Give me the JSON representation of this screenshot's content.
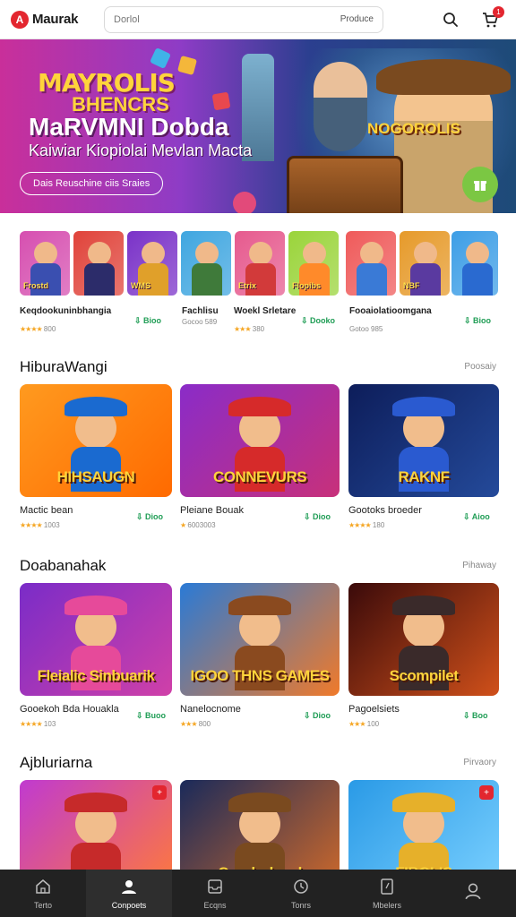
{
  "app": {
    "logo_letter": "A",
    "name": "Maurak"
  },
  "search": {
    "placeholder": "Dorlol",
    "right_label": "Produce"
  },
  "header": {
    "notification_count": "1"
  },
  "hero": {
    "title_line1": "MAYROLIS",
    "title_line2": "BHENCRS",
    "title_line3": "MaRVMNI Dobda",
    "subtitle": "Kaiwiar Kiopiolai Mevlan Macta",
    "side_logo": "NOGOROLIS",
    "cta_label": "Dais Reuschine ciis Sraies"
  },
  "featured": {
    "tiles": [
      {
        "tag": "Frostd",
        "bg": "#d64fb0"
      },
      {
        "tag": "",
        "bg": "#e0433a"
      },
      {
        "tag": "WMS",
        "bg": "#7a32c8"
      },
      {
        "tag": "",
        "bg": "#3fa6e0"
      },
      {
        "tag": "Etrix",
        "bg": "#e65a8e"
      },
      {
        "tag": "Flopibs",
        "bg": "#9ad43a"
      },
      {
        "tag": "",
        "bg": "#ef5a5a"
      },
      {
        "tag": "NBF",
        "bg": "#e69a2a"
      },
      {
        "tag": "",
        "bg": "#3d9ee6"
      }
    ],
    "items": [
      {
        "name": "Keqdookuninbhangia",
        "rating": "★★★★",
        "rating_text": "800",
        "get": "Bioo"
      },
      {
        "name": "Fachlisu",
        "rating": "",
        "rating_text": "Gocoo 589",
        "get": ""
      },
      {
        "name": "Woekl Srletare",
        "rating": "★★★",
        "rating_text": "380",
        "get": "Dooko"
      },
      {
        "name": "Fooaiolatioomgana",
        "rating": "",
        "rating_text": "Gotoo 985",
        "get": "Bioo"
      }
    ]
  },
  "sections": [
    {
      "title": "HiburaWangi",
      "more": "Poosaiy",
      "cards": [
        {
          "caption": "HIHSAUGN",
          "name": "Mactic bean",
          "rating": "★★★★",
          "rating_text": "1003",
          "get": "Dioo"
        },
        {
          "caption": "CONNEVURS",
          "name": "Pleiane Bouak",
          "rating": "★",
          "rating_text": "6003003",
          "get": "Dioo"
        },
        {
          "caption": "RAKNF",
          "name": "Gootoks broeder",
          "rating": "★★★★",
          "rating_text": "180",
          "get": "Aioo"
        }
      ]
    },
    {
      "title": "Doabanahak",
      "more": "Pihaway",
      "cards": [
        {
          "caption": "Fleialic Sinbuarik",
          "name": "Gooekoh Bda Houakla",
          "rating": "★★★★",
          "rating_text": "103",
          "get": "Buoo"
        },
        {
          "caption": "IGOO THNS GAMES",
          "name": "Nanelocnome",
          "rating": "★★★",
          "rating_text": "800",
          "get": "Dioo"
        },
        {
          "caption": "Scompilet",
          "name": "Pagoelsiets",
          "rating": "★★★",
          "rating_text": "100",
          "get": "Boo"
        }
      ]
    },
    {
      "title": "Ajbluriarna",
      "more": "Pirvaory",
      "cards": [
        {
          "caption": "",
          "name": "",
          "rating": "",
          "rating_text": "",
          "get": ""
        },
        {
          "caption": "Cuudrplanel",
          "name": "",
          "rating": "",
          "rating_text": "",
          "get": ""
        },
        {
          "caption": "FIBOLIS",
          "name": "",
          "rating": "",
          "rating_text": "",
          "get": ""
        }
      ]
    }
  ],
  "bottom_nav": [
    {
      "label": "Terto",
      "icon": "home-icon"
    },
    {
      "label": "Conpoets",
      "icon": "profile-icon"
    },
    {
      "label": "Ecqns",
      "icon": "inbox-icon"
    },
    {
      "label": "Tonrs",
      "icon": "clock-icon"
    },
    {
      "label": "Mbelers",
      "icon": "document-icon"
    },
    {
      "label": "",
      "icon": "user-icon"
    }
  ],
  "colors": {
    "brand": "#e3262f",
    "get_green": "#1f9d55",
    "nav_bg": "#222222"
  }
}
